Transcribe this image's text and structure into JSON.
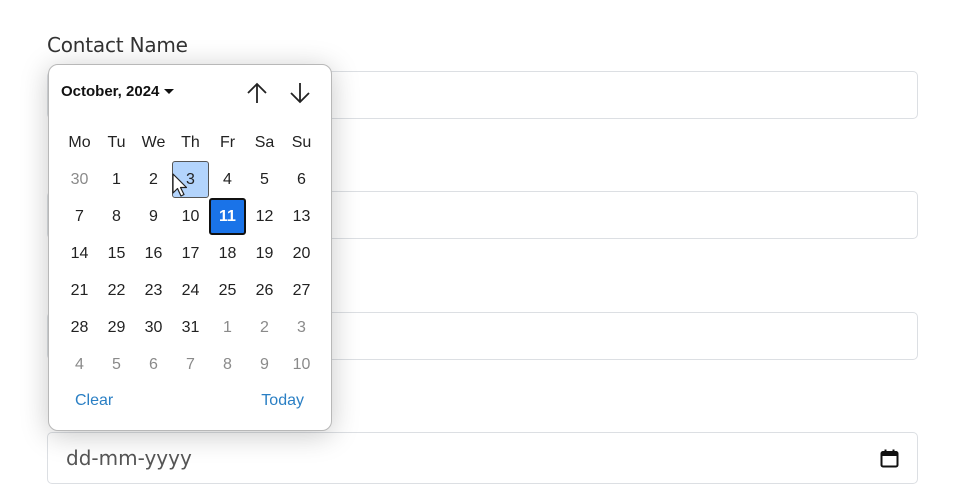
{
  "form": {
    "labels": [
      "Contact Name",
      "",
      "",
      ""
    ],
    "fields": [
      {
        "name": "contact-name",
        "value": ""
      },
      {
        "name": "field-2",
        "value": ""
      },
      {
        "name": "field-3",
        "value": ""
      }
    ],
    "date_input": {
      "placeholder": "dd-mm-yyyy",
      "icon": "calendar-icon"
    }
  },
  "datepicker": {
    "month_label": "October, 2024",
    "nav": {
      "prev_icon": "arrow-up-icon",
      "next_icon": "arrow-down-icon"
    },
    "weekdays": [
      "Mo",
      "Tu",
      "We",
      "Th",
      "Fr",
      "Sa",
      "Su"
    ],
    "weeks": [
      [
        {
          "d": "30",
          "m": true
        },
        {
          "d": "1"
        },
        {
          "d": "2"
        },
        {
          "d": "3",
          "hover": true
        },
        {
          "d": "4"
        },
        {
          "d": "5"
        },
        {
          "d": "6"
        }
      ],
      [
        {
          "d": "7"
        },
        {
          "d": "8"
        },
        {
          "d": "9"
        },
        {
          "d": "10"
        },
        {
          "d": "11",
          "selected": true
        },
        {
          "d": "12"
        },
        {
          "d": "13"
        }
      ],
      [
        {
          "d": "14"
        },
        {
          "d": "15"
        },
        {
          "d": "16"
        },
        {
          "d": "17"
        },
        {
          "d": "18"
        },
        {
          "d": "19"
        },
        {
          "d": "20"
        }
      ],
      [
        {
          "d": "21"
        },
        {
          "d": "22"
        },
        {
          "d": "23"
        },
        {
          "d": "24"
        },
        {
          "d": "25"
        },
        {
          "d": "26"
        },
        {
          "d": "27"
        }
      ],
      [
        {
          "d": "28"
        },
        {
          "d": "29"
        },
        {
          "d": "30"
        },
        {
          "d": "31"
        },
        {
          "d": "1",
          "m": true
        },
        {
          "d": "2",
          "m": true
        },
        {
          "d": "3",
          "m": true
        }
      ],
      [
        {
          "d": "4",
          "m": true
        },
        {
          "d": "5",
          "m": true
        },
        {
          "d": "6",
          "m": true
        },
        {
          "d": "7",
          "m": true
        },
        {
          "d": "8",
          "m": true
        },
        {
          "d": "9",
          "m": true
        },
        {
          "d": "10",
          "m": true
        }
      ]
    ],
    "selected_day": "11",
    "hovered_day": "3",
    "clear_label": "Clear",
    "today_label": "Today",
    "colors": {
      "selected": "#1a73e8",
      "hover": "#b3d4fc",
      "link": "#2a7fc4"
    }
  }
}
